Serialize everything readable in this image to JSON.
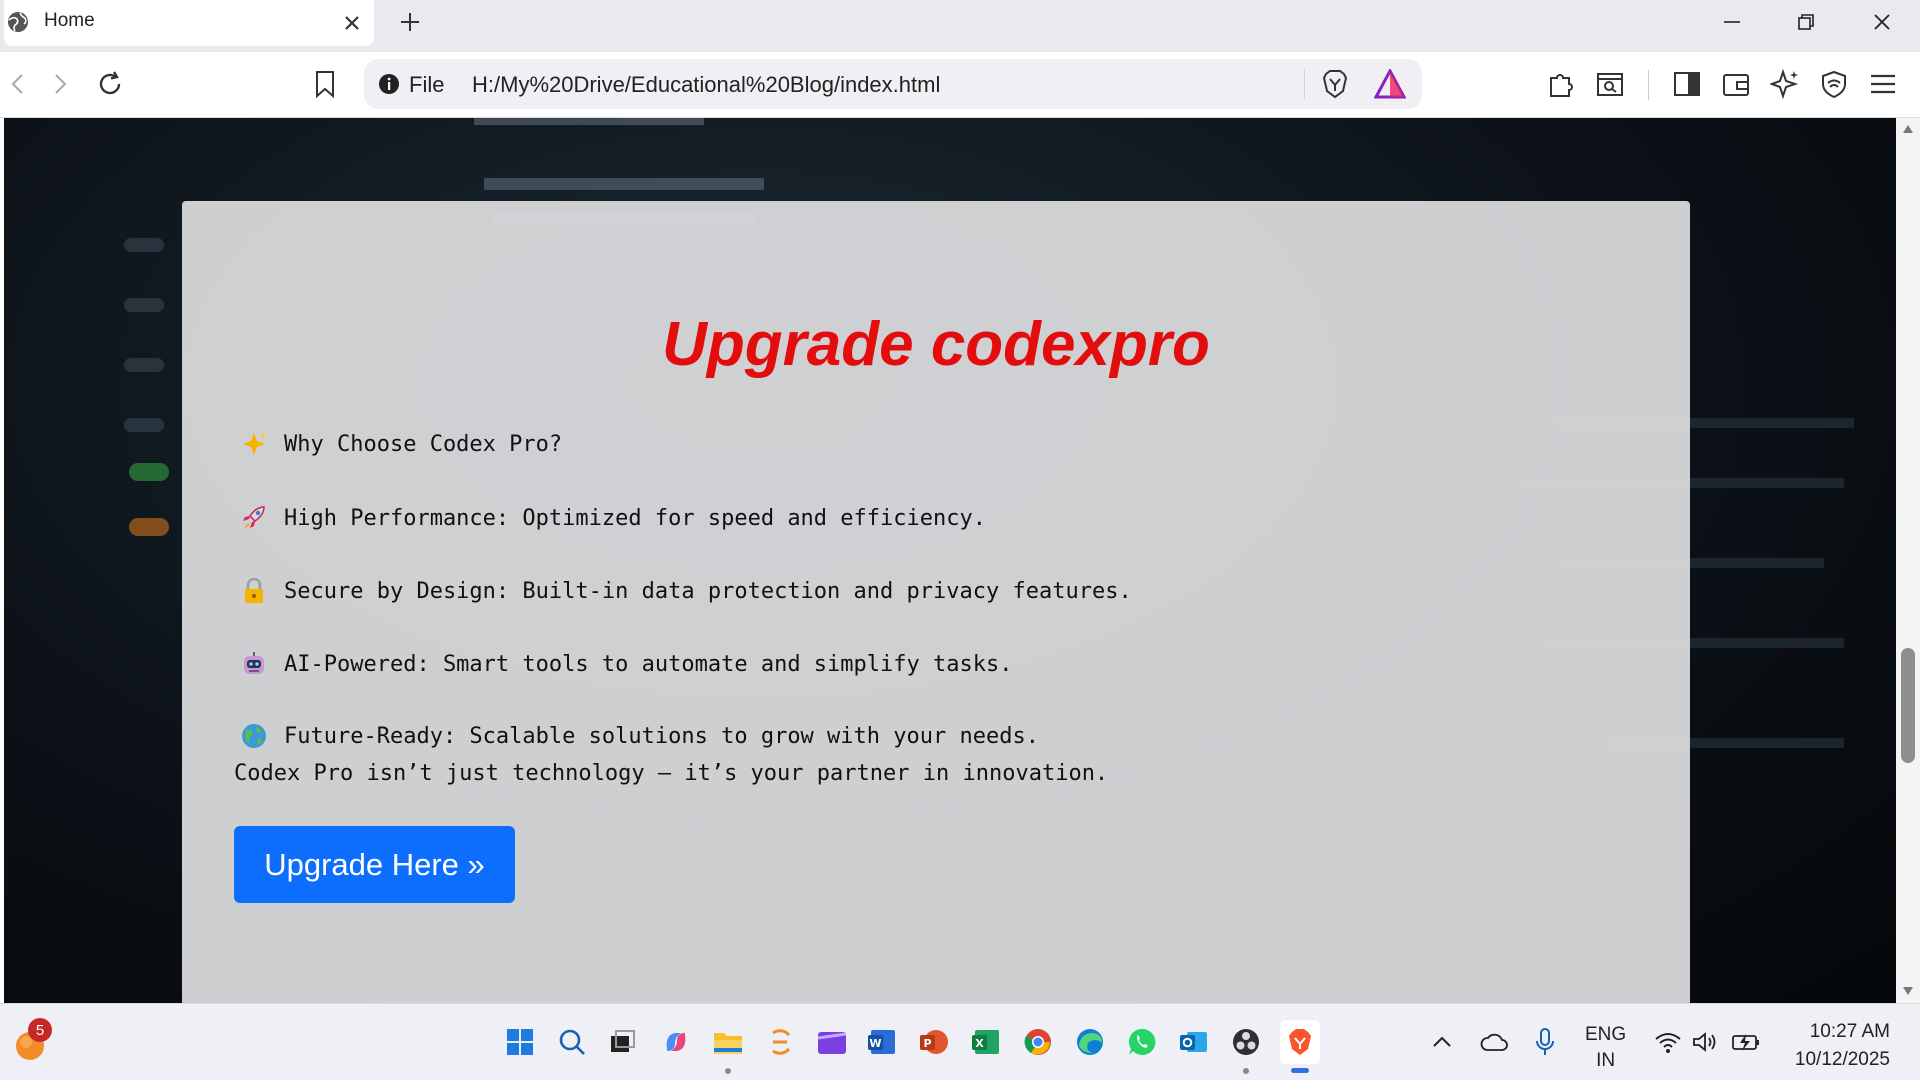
{
  "browser": {
    "tab_title": "Home",
    "url_scheme": "File",
    "url": "H:/My%20Drive/Educational%20Blog/index.html"
  },
  "page": {
    "title": "Upgrade codexpro",
    "features": [
      {
        "icon": "sparkles-icon",
        "text": "Why Choose Codex Pro?"
      },
      {
        "icon": "rocket-icon",
        "text": "High Performance: Optimized for speed and efficiency."
      },
      {
        "icon": "lock-icon",
        "text": "Secure by Design: Built-in data protection and privacy features."
      },
      {
        "icon": "robot-icon",
        "text": "AI-Powered: Smart tools to automate and simplify tasks."
      },
      {
        "icon": "globe-icon",
        "text": "Future-Ready: Scalable solutions to grow with your needs."
      }
    ],
    "tagline": "Codex Pro isn’t just technology — it’s your partner in innovation.",
    "cta_label": "Upgrade Here »",
    "title_color": "#e40d0d",
    "cta_color": "#0d6efd"
  },
  "taskbar": {
    "notification_count": "5",
    "lang_line1": "ENG",
    "lang_line2": "IN",
    "time": "10:27 AM",
    "date": "10/12/2025"
  }
}
